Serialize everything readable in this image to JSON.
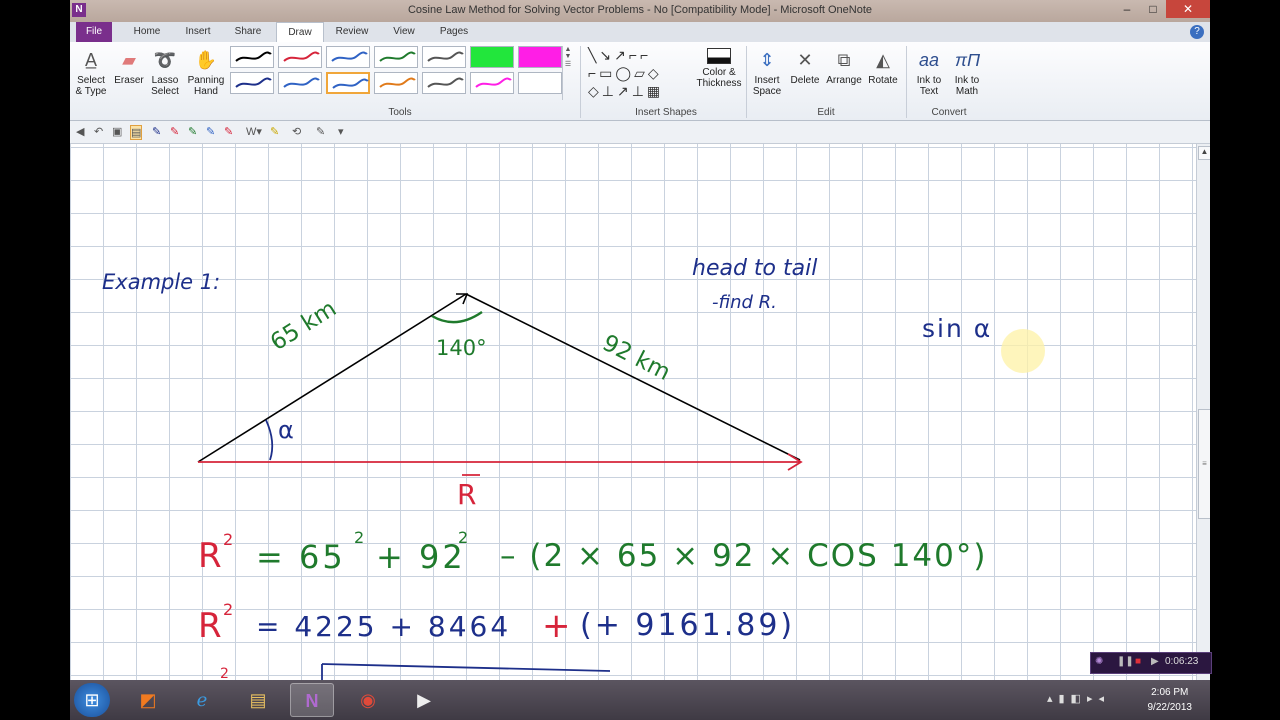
{
  "window": {
    "title": "Cosine Law Method for Solving Vector Problems - No [Compatibility Mode] - Microsoft OneNote",
    "app_icon": "N",
    "controls": [
      "–",
      "□",
      "✕"
    ]
  },
  "ribbon_tabs": [
    "File",
    "Home",
    "Insert",
    "Share",
    "Draw",
    "Review",
    "View",
    "Pages"
  ],
  "active_tab": "Draw",
  "tools_group": {
    "buttons": [
      {
        "label": "Select\n& Type",
        "icon": "select-type-icon"
      },
      {
        "label": "Eraser",
        "icon": "eraser-icon"
      },
      {
        "label": "Lasso\nSelect",
        "icon": "lasso-icon"
      },
      {
        "label": "Panning\nHand",
        "icon": "hand-icon"
      }
    ],
    "pens": [
      {
        "color": "#000000"
      },
      {
        "color": "#d6243a"
      },
      {
        "color": "#2f62c4"
      },
      {
        "color": "#1f7a2c"
      },
      {
        "color": "#555555"
      },
      {
        "color": "#22e63c",
        "highlighter": true
      },
      {
        "color": "#ff1ee6",
        "highlighter": true
      },
      {
        "color": "#1d2f8a"
      },
      {
        "color": "#2f62c4"
      },
      {
        "color": "#2f62c4",
        "selected": true
      },
      {
        "color": "#e07a1a"
      },
      {
        "color": "#555555"
      },
      {
        "color": "#ff1ee6"
      },
      {
        "color": "#ffffff"
      }
    ],
    "group_label": "Tools"
  },
  "shapes_group": {
    "color_thickness": "Color &\nThickness",
    "group_label": "Insert Shapes"
  },
  "edit_group": {
    "buttons": [
      {
        "label": "Insert\nSpace",
        "icon": "insert-space-icon"
      },
      {
        "label": "Delete",
        "icon": "delete-icon"
      },
      {
        "label": "Arrange",
        "icon": "arrange-icon"
      },
      {
        "label": "Rotate",
        "icon": "rotate-icon"
      }
    ],
    "group_label": "Edit"
  },
  "convert_group": {
    "buttons": [
      {
        "label": "Ink to\nText",
        "icon": "ink-to-text-icon"
      },
      {
        "label": "Ink to\nMath",
        "icon": "ink-to-math-icon"
      }
    ],
    "group_label": "Convert"
  },
  "notes": {
    "example_label": "Example 1:",
    "head_to_tail": "head to tail",
    "find_r": "-find R.",
    "sin_alpha": "sin α",
    "side_a": "65 km",
    "side_b": "92 km",
    "angle": "140°",
    "alpha": "α",
    "resultant": "R",
    "eq1_lhs": "R",
    "eq1_rhs_a": "= 65",
    "eq1_rhs_b": "+ 92",
    "eq1_rhs_c": "– (2 × 65 × 92 × COS 140°)",
    "eq2_lhs": "R",
    "eq2_rhs": "= 4225 + 8464",
    "eq2_plus": "+",
    "eq2_paren": "(+ 9161.89)"
  },
  "recorder": {
    "time": "0:06:23"
  },
  "taskbar": {
    "icons": [
      "windows-start-icon",
      "office-icon",
      "internet-explorer-icon",
      "file-explorer-icon",
      "onenote-icon",
      "chrome-icon",
      "media-icon"
    ],
    "clock_time": "2:06 PM",
    "clock_date": "9/22/2013"
  }
}
